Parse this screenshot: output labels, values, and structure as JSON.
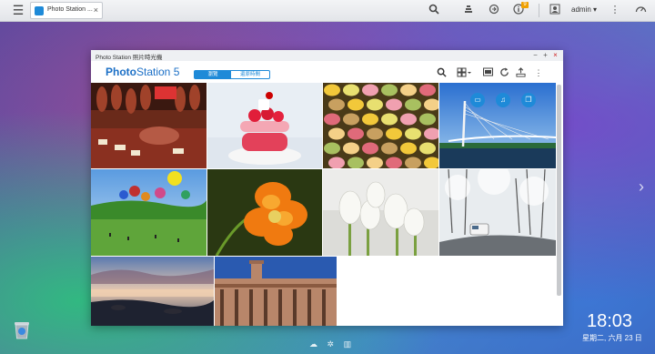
{
  "taskbar": {
    "tab_label": "Photo Station ...",
    "tab_close": "×",
    "notification_count": "9",
    "user": "admin ▾"
  },
  "window": {
    "title": "Photo Station 照片時光機",
    "app_name_bold": "Photo",
    "app_name_rest": "Station 5",
    "seg_active": "瀏覽",
    "seg_inactive": "還原時間"
  },
  "desktop": {
    "time": "18:03",
    "date": "星期二, 六月 23 日"
  },
  "icons": {
    "menu": "menu-icon",
    "search": "search-icon",
    "stack": "stack-icon",
    "refresh": "sync-icon",
    "info": "info-icon",
    "user": "user-icon",
    "more": "more-icon",
    "dashboard": "gauge-icon",
    "trash": "trash-icon"
  },
  "colors": {
    "accent": "#1e8ad8",
    "logo": "#1b6fc6",
    "badge": "#f0a000"
  }
}
